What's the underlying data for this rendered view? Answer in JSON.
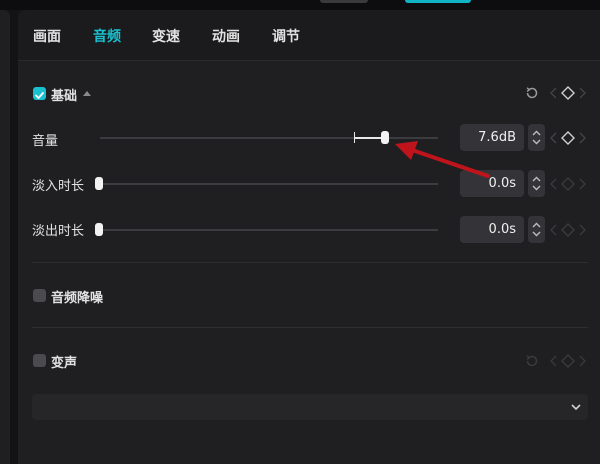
{
  "tabs": [
    {
      "label": "画面",
      "active": false
    },
    {
      "label": "音频",
      "active": true
    },
    {
      "label": "变速",
      "active": false
    },
    {
      "label": "动画",
      "active": false
    },
    {
      "label": "调节",
      "active": false
    }
  ],
  "basic": {
    "title": "基础",
    "checked": true,
    "rows": [
      {
        "label": "音量",
        "value": "7.6dB",
        "slider_fraction": 0.85
      },
      {
        "label": "淡入时长",
        "value": "0.0s",
        "slider_fraction": 0.0
      },
      {
        "label": "淡出时长",
        "value": "0.0s",
        "slider_fraction": 0.0
      }
    ]
  },
  "denoise": {
    "title": "音频降噪",
    "checked": false
  },
  "voice_change": {
    "title": "变声",
    "checked": false
  },
  "colors": {
    "accent": "#19c0cf",
    "annotation_arrow": "#c0141c"
  },
  "icons": [
    "reset-icon",
    "keyframe-diamond-icon",
    "chevron-left-icon",
    "chevron-right-icon",
    "stepper-icon",
    "chevron-down-icon"
  ]
}
